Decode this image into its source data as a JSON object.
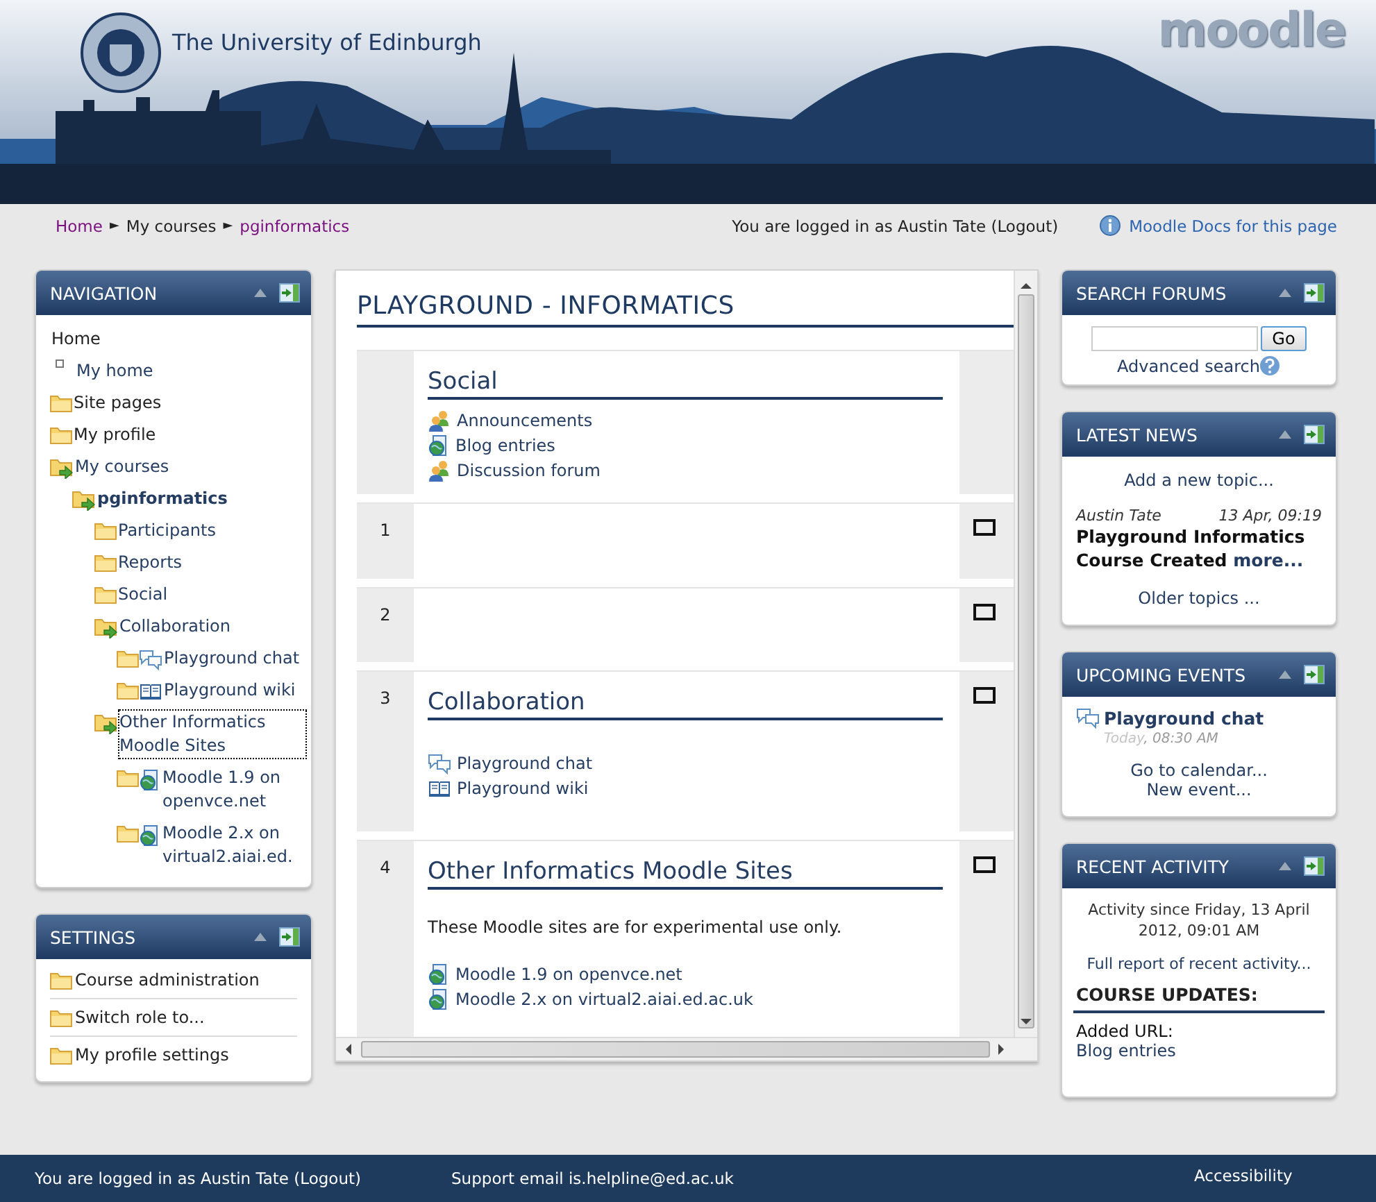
{
  "header": {
    "org": "The University of Edinburgh",
    "logo": "moodle"
  },
  "breadcrumb": {
    "separator": "►",
    "items": [
      {
        "label": "Home",
        "visited": true
      },
      {
        "label": "My courses",
        "visited": false
      },
      {
        "label": "pginformatics",
        "visited": true
      }
    ]
  },
  "login_info": "You are logged in as Austin Tate (Logout)",
  "docs_link": "Moodle Docs for this page",
  "navigation": {
    "title": "NAVIGATION",
    "items": [
      {
        "label": "Home",
        "kind": "plain",
        "current": false,
        "focused": false
      },
      {
        "label": "My home",
        "kind": "bullet",
        "current": false,
        "focused": false
      },
      {
        "label": "Site pages",
        "kind": "folder",
        "current": false,
        "focused": false
      },
      {
        "label": "My profile",
        "kind": "folder",
        "current": false,
        "focused": false
      },
      {
        "label": "My courses",
        "kind": "folder-arrow",
        "current": false,
        "focused": false,
        "children": [
          {
            "label": "pginformatics",
            "kind": "folder-arrow",
            "current": true,
            "focused": false,
            "children": [
              {
                "label": "Participants",
                "kind": "folder",
                "current": false,
                "focused": false
              },
              {
                "label": "Reports",
                "kind": "folder",
                "current": false,
                "focused": false
              },
              {
                "label": "Social",
                "kind": "folder",
                "current": false,
                "focused": false
              },
              {
                "label": "Collaboration",
                "kind": "folder-arrow",
                "current": false,
                "focused": false,
                "children": [
                  {
                    "label": "Playground chat",
                    "kind": "chat",
                    "current": false,
                    "focused": false
                  },
                  {
                    "label": "Playground wiki",
                    "kind": "wiki",
                    "current": false,
                    "focused": false
                  }
                ]
              },
              {
                "label": "Other Informatics Moodle Sites",
                "kind": "folder-arrow",
                "current": false,
                "focused": true,
                "children": [
                  {
                    "label": "Moodle 1.9 on openvce.net",
                    "kind": "url",
                    "current": false,
                    "focused": false
                  },
                  {
                    "label": "Moodle 2.x on virtual2.aiai.ed.",
                    "kind": "url",
                    "current": false,
                    "focused": false
                  }
                ]
              }
            ]
          }
        ]
      }
    ]
  },
  "settings": {
    "title": "SETTINGS",
    "items": [
      {
        "label": "Course administration"
      },
      {
        "label": "Switch role to..."
      },
      {
        "label": "My profile settings"
      }
    ]
  },
  "course": {
    "title": "PLAYGROUND - INFORMATICS",
    "sections": [
      {
        "title": "Social",
        "show_marker": false,
        "activities": [
          {
            "kind": "forum",
            "label": "Announcements"
          },
          {
            "kind": "url",
            "label": "Blog entries"
          },
          {
            "kind": "forum",
            "label": "Discussion forum"
          }
        ]
      },
      {
        "number": "1",
        "show_marker": true
      },
      {
        "number": "2",
        "show_marker": true
      },
      {
        "number": "3",
        "title": "Collaboration",
        "show_marker": true,
        "activities": [
          {
            "kind": "chat",
            "label": "Playground chat"
          },
          {
            "kind": "wiki",
            "label": "Playground wiki"
          }
        ]
      },
      {
        "number": "4",
        "title": "Other Informatics Moodle Sites",
        "summary": "These Moodle sites are for experimental use only.",
        "show_marker": true,
        "activities": [
          {
            "kind": "url",
            "label": "Moodle 1.9 on openvce.net"
          },
          {
            "kind": "url",
            "label": "Moodle 2.x on virtual2.aiai.ed.ac.uk"
          }
        ]
      }
    ]
  },
  "search_forums": {
    "title": "SEARCH FORUMS",
    "button": "Go",
    "advanced": "Advanced search"
  },
  "latest_news": {
    "title": "LATEST NEWS",
    "add": "Add a new topic...",
    "author": "Austin Tate",
    "date": "13 Apr, 09:19",
    "headline": "Playground Informatics Course Created",
    "more": "more...",
    "older": "Older topics ..."
  },
  "upcoming_events": {
    "title": "UPCOMING EVENTS",
    "event": "Playground chat",
    "day": "Today",
    "time": ", 08:30 AM",
    "links": [
      "Go to calendar...",
      "New event..."
    ]
  },
  "recent_activity": {
    "title": "RECENT ACTIVITY",
    "since": "Activity since Friday, 13 April 2012, 09:01 AM",
    "report": "Full report of recent activity...",
    "heading": "COURSE UPDATES:",
    "update_label": "Added URL:",
    "update_item": "Blog entries"
  },
  "footer": {
    "login": "You are logged in as Austin Tate (Logout)",
    "support": "Support email is.helpline@ed.ac.uk",
    "accessibility": "Accessibility"
  }
}
